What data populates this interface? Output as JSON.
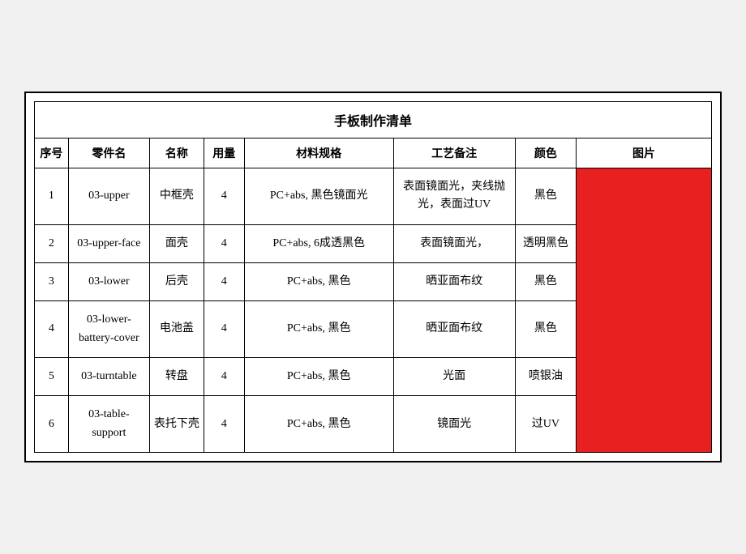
{
  "title": "手板制作清单",
  "headers": {
    "seq": "序号",
    "part_id": "零件名",
    "name": "名称",
    "qty": "用量",
    "spec": "材料规格",
    "process": "工艺备注",
    "color": "颜色",
    "image": "图片"
  },
  "rows": [
    {
      "seq": "1",
      "part_id": "03-upper",
      "name": "中框壳",
      "qty": "4",
      "spec": "PC+abs, 黑色镜面光",
      "process": "表面镜面光，夹线抛光，表面过UV",
      "color": "黑色"
    },
    {
      "seq": "2",
      "part_id": "03-upper-face",
      "name": "面壳",
      "qty": "4",
      "spec": "PC+abs, 6成透黑色",
      "process": "表面镜面光，",
      "color": "透明黑色"
    },
    {
      "seq": "3",
      "part_id": "03-lower",
      "name": "后壳",
      "qty": "4",
      "spec": "PC+abs, 黑色",
      "process": "晒亚面布纹",
      "color": "黑色"
    },
    {
      "seq": "4",
      "part_id": "03-lower-battery-cover",
      "name": "电池盖",
      "qty": "4",
      "spec": "PC+abs, 黑色",
      "process": "晒亚面布纹",
      "color": "黑色"
    },
    {
      "seq": "5",
      "part_id": "03-turntable",
      "name": "转盘",
      "qty": "4",
      "spec": "PC+abs, 黑色",
      "process": "光面",
      "color": "喷银油"
    },
    {
      "seq": "6",
      "part_id": "03-table-support",
      "name": "表托下壳",
      "qty": "4",
      "spec": "PC+abs, 黑色",
      "process": "镜面光",
      "color": "过UV"
    }
  ],
  "image_bg_color": "#e82020"
}
